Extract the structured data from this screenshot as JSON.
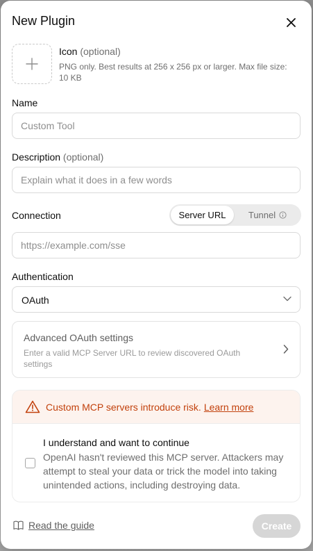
{
  "modal": {
    "title": "New Plugin"
  },
  "icon_section": {
    "title": "Icon",
    "optional": "(optional)",
    "hint": "PNG only. Best results at 256 x 256 px or larger. Max file size: 10 KB"
  },
  "name": {
    "label": "Name",
    "placeholder": "Custom Tool",
    "value": ""
  },
  "description": {
    "label": "Description",
    "optional": "(optional)",
    "placeholder": "Explain what it does in a few words",
    "value": ""
  },
  "connection": {
    "label": "Connection",
    "options": [
      "Server URL",
      "Tunnel"
    ],
    "selected": "Server URL",
    "url_placeholder": "https://example.com/sse",
    "url_value": ""
  },
  "authentication": {
    "label": "Authentication",
    "selected": "OAuth"
  },
  "advanced": {
    "title": "Advanced OAuth settings",
    "description": "Enter a valid MCP Server URL to review discovered OAuth settings"
  },
  "risk": {
    "message": "Custom MCP servers introduce risk.",
    "link": "Learn more",
    "consent_title": "I understand and want to continue",
    "consent_desc": "OpenAI hasn't reviewed this MCP server. Attackers may attempt to steal your data or trick the model into taking unintended actions, including destroying data.",
    "checked": false
  },
  "footer": {
    "guide_label": "Read the guide",
    "create_label": "Create"
  },
  "colors": {
    "warning": "#c2410c",
    "warning_bg": "#fdf3ee",
    "button_disabled": "#d6d6d6"
  },
  "icons": {
    "close": "close-icon",
    "add": "plus-icon",
    "info": "info-icon",
    "dropdown": "chevron-down-icon",
    "advanced": "chevron-right-icon",
    "warning": "warning-icon",
    "guide": "book-icon"
  }
}
